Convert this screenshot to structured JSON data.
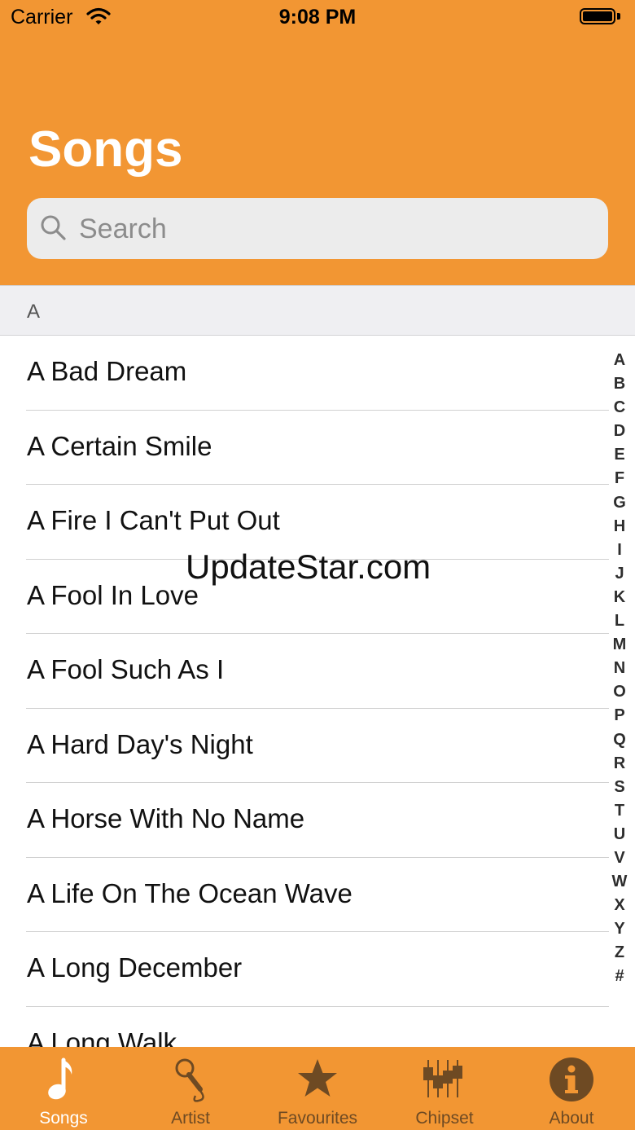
{
  "status_bar": {
    "carrier": "Carrier",
    "time": "9:08 PM"
  },
  "header": {
    "title": "Songs",
    "search_placeholder": "Search"
  },
  "section": {
    "letter": "A"
  },
  "songs": [
    "A Bad Dream",
    "A Certain Smile",
    "A Fire I Can't Put Out",
    "A Fool In Love",
    "A Fool Such As I",
    "A Hard Day's Night",
    "A Horse With No Name",
    "A Life On The Ocean Wave",
    "A Long December",
    "A Long Walk"
  ],
  "index_letters": [
    "A",
    "B",
    "C",
    "D",
    "E",
    "F",
    "G",
    "H",
    "I",
    "J",
    "K",
    "L",
    "M",
    "N",
    "O",
    "P",
    "Q",
    "R",
    "S",
    "T",
    "U",
    "V",
    "W",
    "X",
    "Y",
    "Z",
    "#"
  ],
  "watermark": "UpdateStar.com",
  "tabs": [
    {
      "label": "Songs",
      "icon": "music-note-icon",
      "active": true
    },
    {
      "label": "Artist",
      "icon": "microphone-icon",
      "active": false
    },
    {
      "label": "Favourites",
      "icon": "star-icon",
      "active": false
    },
    {
      "label": "Chipset",
      "icon": "chipset-icon",
      "active": false
    },
    {
      "label": "About",
      "icon": "info-icon",
      "active": false
    }
  ],
  "colors": {
    "accent": "#f29633",
    "tab_active": "#ffffff",
    "tab_inactive": "#6e4a23"
  }
}
